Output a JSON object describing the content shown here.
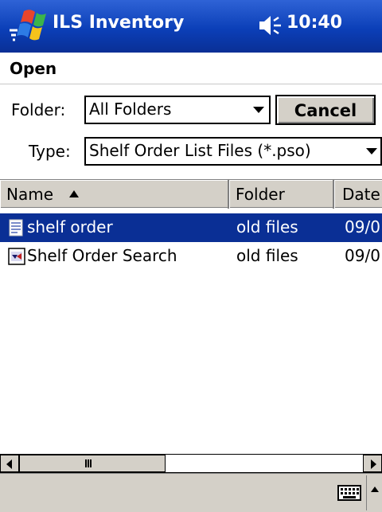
{
  "titlebar": {
    "app_title": "ILS Inventory",
    "time": "10:40",
    "background": "#0b3fb8"
  },
  "dialog": {
    "title": "Open"
  },
  "form": {
    "folder_label": "Folder:",
    "folder_value": "All Folders",
    "type_label": "Type:",
    "type_value": "Shelf Order List Files (*.pso)",
    "cancel_label": "Cancel"
  },
  "columns": [
    {
      "label": "Name"
    },
    {
      "label": "Folder"
    },
    {
      "label": "Date"
    }
  ],
  "files": [
    {
      "name": "shelf order",
      "folder": "old files",
      "date": "09/0",
      "selected": true
    },
    {
      "name": "Shelf Order Search",
      "folder": "old files",
      "date": "09/0",
      "selected": false
    }
  ],
  "colors": {
    "selection": "#0a2f95",
    "chrome": "#d4d0c8"
  }
}
